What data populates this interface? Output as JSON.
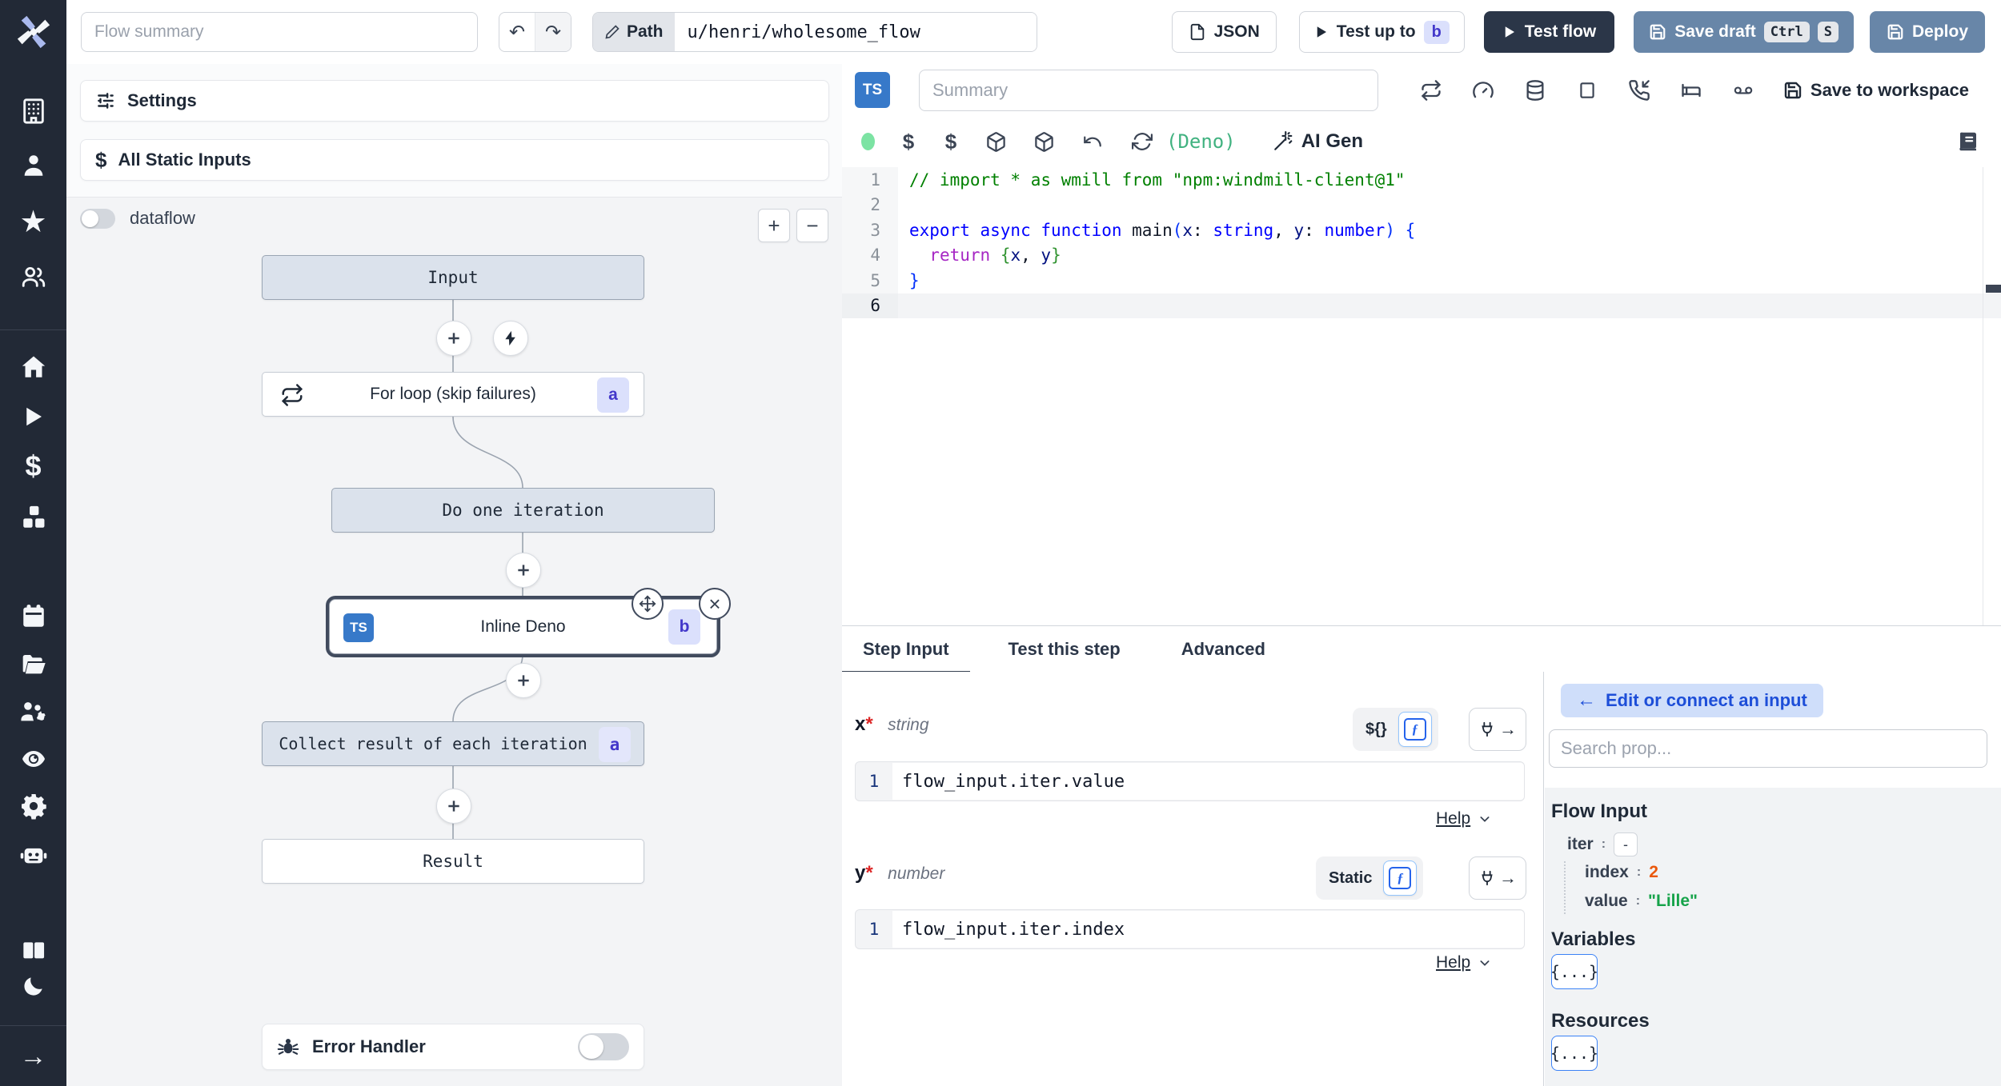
{
  "colors": {
    "sidebar_bg": "#222936",
    "steel_button": "#6886a8",
    "dark_button": "#2b3648",
    "badge_bg": "#dbe0fc",
    "badge_text": "#4338ca",
    "accent_blue": "#2563eb",
    "green": "#16a34a",
    "orange": "#ea580c",
    "deno_green": "#41b280",
    "status_dot": "#7ce3a3",
    "node_fill": "#dbe2ec"
  },
  "topbar": {
    "flow_summary_placeholder": "Flow summary",
    "path_label": "Path",
    "path_value": "u/henri/wholesome_flow",
    "json_label": "JSON",
    "test_up_to_label": "Test up to",
    "test_up_to_badge": "b",
    "test_flow_label": "Test flow",
    "save_draft_label": "Save draft",
    "kbd_ctrl": "Ctrl",
    "kbd_s": "S",
    "deploy_label": "Deploy"
  },
  "sidebar": {
    "icons": [
      "windmill-logo",
      "building",
      "user",
      "star",
      "users",
      "home",
      "play",
      "dollar",
      "cubes",
      "calendar",
      "folder",
      "users-gear",
      "eye",
      "gear",
      "robot",
      "books",
      "moon",
      "arrow-right"
    ]
  },
  "flow_panel": {
    "settings_label": "Settings",
    "static_inputs_label": "All Static Inputs",
    "dataflow_label": "dataflow",
    "zoom_in": "+",
    "zoom_out": "−",
    "nodes": {
      "input": {
        "label": "Input"
      },
      "for_loop": {
        "label": "For loop (skip failures)",
        "badge": "a"
      },
      "do_iteration": {
        "label": "Do one iteration"
      },
      "inline_deno": {
        "label": "Inline Deno",
        "badge": "b",
        "lang": "TS"
      },
      "collect": {
        "label": "Collect result of each iteration",
        "badge": "a"
      },
      "result": {
        "label": "Result"
      }
    },
    "error_handler_label": "Error Handler"
  },
  "editor": {
    "lang_badge": "TS",
    "summary_placeholder": "Summary",
    "save_to_workspace_label": "Save to workspace",
    "deno_label": "(Deno)",
    "ai_gen_label": "AI Gen",
    "code": {
      "lines": [
        {
          "n": "1",
          "tokens": [
            [
              "// import * as wmill from \"npm:windmill-client@1\"",
              "comment"
            ]
          ]
        },
        {
          "n": "2",
          "tokens": []
        },
        {
          "n": "3",
          "tokens": [
            [
              "export async function ",
              "kw"
            ],
            [
              "main",
              "p"
            ],
            [
              "(",
              "b1"
            ],
            [
              "x",
              "var"
            ],
            [
              ": ",
              "p"
            ],
            [
              "string",
              "kw"
            ],
            [
              ", ",
              "p"
            ],
            [
              "y",
              "var"
            ],
            [
              ": ",
              "p"
            ],
            [
              "number",
              "kw"
            ],
            [
              ")",
              "b1"
            ],
            [
              " ",
              "p"
            ],
            [
              "{",
              "b1"
            ]
          ]
        },
        {
          "n": "4",
          "tokens": [
            [
              "  ",
              "p"
            ],
            [
              "return",
              "ctrl"
            ],
            [
              " ",
              "p"
            ],
            [
              "{",
              "b2"
            ],
            [
              "x",
              "var"
            ],
            [
              ", ",
              "p"
            ],
            [
              "y",
              "var"
            ],
            [
              "}",
              "b2"
            ]
          ]
        },
        {
          "n": "5",
          "tokens": [
            [
              "}",
              "b1"
            ]
          ]
        },
        {
          "n": "6",
          "tokens": [],
          "current": true
        }
      ]
    }
  },
  "tabs": {
    "step_input": "Step Input",
    "test_this_step": "Test this step",
    "advanced": "Advanced"
  },
  "step_input": {
    "x": {
      "name": "x",
      "required": "*",
      "type": "string",
      "toggle_label": "${}",
      "code_line_no": "1",
      "code": "flow_input.iter.value",
      "help": "Help"
    },
    "y": {
      "name": "y",
      "required": "*",
      "type": "number",
      "toggle_label": "Static",
      "code_line_no": "1",
      "code": "flow_input.iter.index",
      "help": "Help"
    }
  },
  "connect_panel": {
    "back_arrow": "←",
    "back_label": "Edit or connect an input",
    "search_placeholder": "Search prop...",
    "flow_input_title": "Flow Input",
    "tree": {
      "iter_key": "iter",
      "iter_colon": ":",
      "collapse": "-",
      "index_key": "index",
      "index_colon": ":",
      "index_value": "2",
      "value_key": "value",
      "value_colon": ":",
      "value_value": "\"Lille\""
    },
    "variables_title": "Variables",
    "variables_button": "{...}",
    "resources_title": "Resources",
    "resources_button": "{...}"
  }
}
